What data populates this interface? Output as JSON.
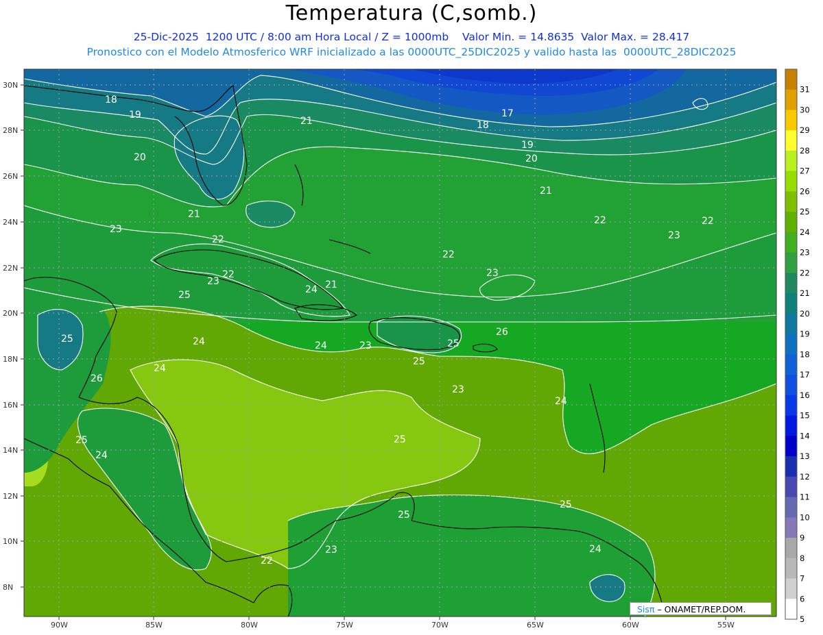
{
  "header": {
    "title": "Temperatura (C,somb.)",
    "subtitle_line1": "25-Dic-2025  1200 UTC / 8:00 am Hora Local / Z = 1000mb    Valor Min. = 14.8635  Valor Max. = 28.417",
    "subtitle_line2": "Pronostico con el Modelo Atmosferico WRF inicializado a las 0000UTC_25DIC2025 y valido hasta las  0000UTC_28DIC2025"
  },
  "credit": {
    "logo": "Sisπ",
    "text": "– ONAMET/REP.DOM."
  },
  "map": {
    "lat_ticks": [
      "30N",
      "28N",
      "26N",
      "24N",
      "22N",
      "20N",
      "18N",
      "16N",
      "14N",
      "12N",
      "10N",
      "8N"
    ],
    "lon_ticks": [
      "90W",
      "85W",
      "80W",
      "75W",
      "70W",
      "65W",
      "60W",
      "55W"
    ],
    "contour_labels": [
      "18",
      "19",
      "20",
      "21",
      "17",
      "18",
      "19",
      "20",
      "21",
      "21",
      "22",
      "22",
      "22",
      "23",
      "22",
      "23",
      "23",
      "22",
      "23",
      "24",
      "21",
      "25",
      "26",
      "25",
      "24",
      "24",
      "24",
      "23",
      "25",
      "25",
      "26",
      "23",
      "24",
      "25",
      "25",
      "24",
      "25",
      "25",
      "23",
      "22",
      "24"
    ]
  },
  "colorbar": {
    "labels": [
      "31",
      "30",
      "29",
      "28",
      "27",
      "26",
      "25",
      "24",
      "23",
      "22",
      "21",
      "20",
      "19",
      "18",
      "17",
      "16",
      "15",
      "14",
      "13",
      "12",
      "11",
      "10",
      "9",
      "8",
      "7",
      "6",
      "5"
    ],
    "colors": [
      "#c88000",
      "#e0a000",
      "#f8c800",
      "#ffff30",
      "#b8f020",
      "#98dc00",
      "#80be00",
      "#60b000",
      "#40b020",
      "#30a040",
      "#208860",
      "#10807c",
      "#1078a0",
      "#1070c0",
      "#1060d8",
      "#1050e0",
      "#0838e8",
      "#0018e0",
      "#0000c8",
      "#1830b0",
      "#4848b0",
      "#6868b0",
      "#8478b8",
      "#a8a8a8",
      "#b8b8b8",
      "#d0d0d0",
      "#ffffff"
    ]
  }
}
